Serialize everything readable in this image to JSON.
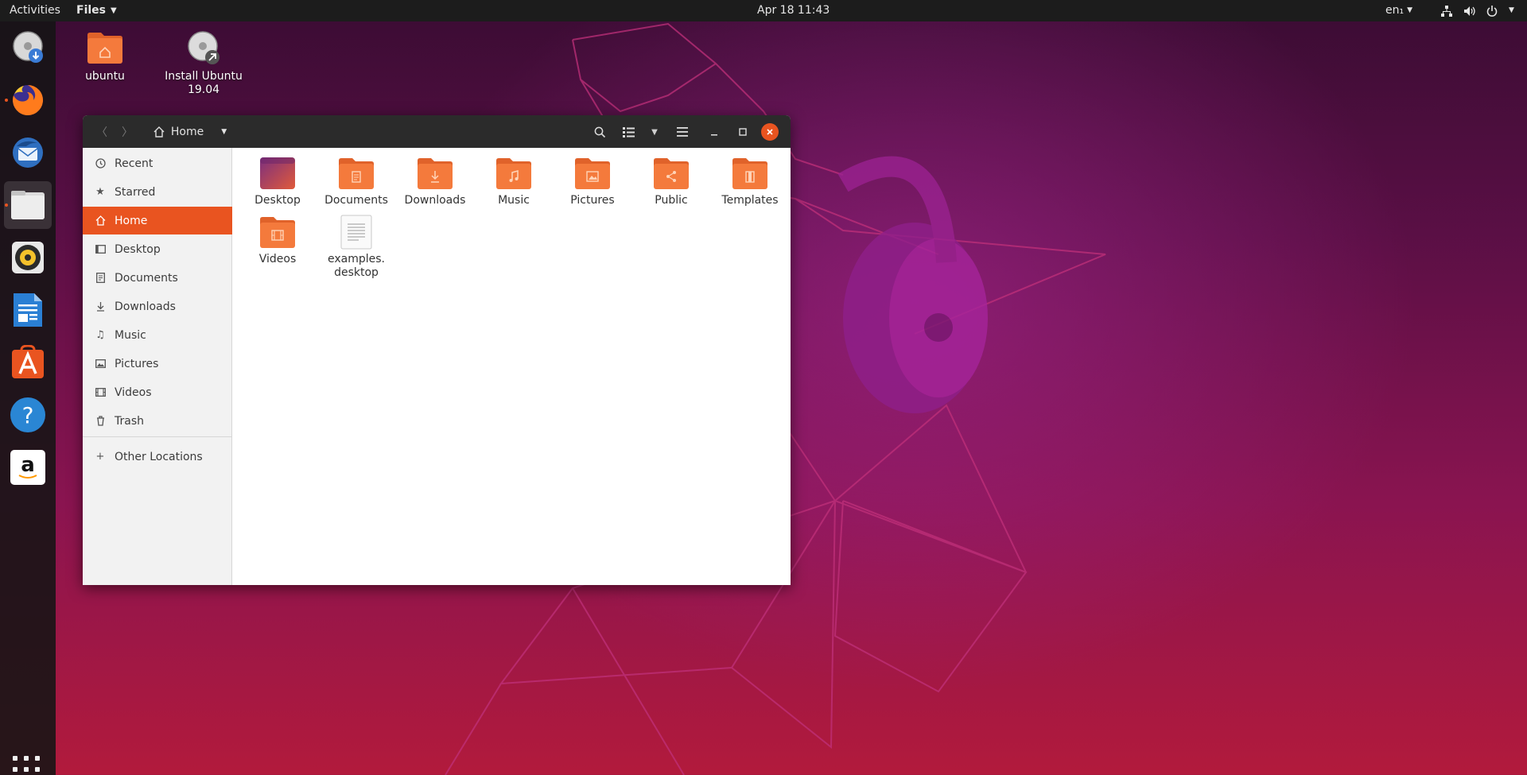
{
  "topbar": {
    "activities": "Activities",
    "app_menu": "Files",
    "clock": "Apr 18  11:43",
    "language": "en₁"
  },
  "dock": {
    "items": [
      {
        "name": "install-ubuntu",
        "icon": "disk-installer-icon"
      },
      {
        "name": "firefox",
        "icon": "firefox-icon"
      },
      {
        "name": "thunderbird",
        "icon": "thunderbird-icon"
      },
      {
        "name": "files",
        "icon": "files-icon",
        "active": true
      },
      {
        "name": "rhythmbox",
        "icon": "rhythmbox-icon"
      },
      {
        "name": "libreoffice-writer",
        "icon": "writer-icon"
      },
      {
        "name": "ubuntu-software",
        "icon": "software-icon"
      },
      {
        "name": "help",
        "icon": "help-icon"
      },
      {
        "name": "amazon",
        "icon": "amazon-icon"
      }
    ],
    "help_glyph": "?",
    "amazon_glyph": "a"
  },
  "desktop": {
    "icons": [
      {
        "label": "ubuntu",
        "icon": "home-folder-icon"
      },
      {
        "label": "Install Ubuntu\n19.04",
        "icon": "installer-disk-icon"
      }
    ]
  },
  "window": {
    "path": "Home",
    "sidebar": {
      "items": [
        {
          "label": "Recent",
          "icon": "clock-icon"
        },
        {
          "label": "Starred",
          "icon": "star-icon"
        },
        {
          "label": "Home",
          "icon": "home-icon",
          "active": true
        },
        {
          "label": "Desktop",
          "icon": "desktop-icon"
        },
        {
          "label": "Documents",
          "icon": "document-icon"
        },
        {
          "label": "Downloads",
          "icon": "download-icon"
        },
        {
          "label": "Music",
          "icon": "music-icon"
        },
        {
          "label": "Pictures",
          "icon": "picture-icon"
        },
        {
          "label": "Videos",
          "icon": "video-icon"
        },
        {
          "label": "Trash",
          "icon": "trash-icon"
        }
      ],
      "other_locations": "Other Locations"
    },
    "files": [
      {
        "label": "Desktop",
        "icon": "desktop-folder-icon"
      },
      {
        "label": "Documents",
        "icon": "documents-folder-icon"
      },
      {
        "label": "Downloads",
        "icon": "downloads-folder-icon"
      },
      {
        "label": "Music",
        "icon": "music-folder-icon"
      },
      {
        "label": "Pictures",
        "icon": "pictures-folder-icon"
      },
      {
        "label": "Public",
        "icon": "public-folder-icon"
      },
      {
        "label": "Templates",
        "icon": "templates-folder-icon"
      },
      {
        "label": "Videos",
        "icon": "videos-folder-icon"
      },
      {
        "label": "examples.\ndesktop",
        "icon": "text-file-icon"
      }
    ]
  },
  "colors": {
    "accent": "#e95420",
    "folder_orange": "#f47a3c",
    "topbar": "#1c1c1c",
    "headerbar": "#2b2b2b"
  }
}
